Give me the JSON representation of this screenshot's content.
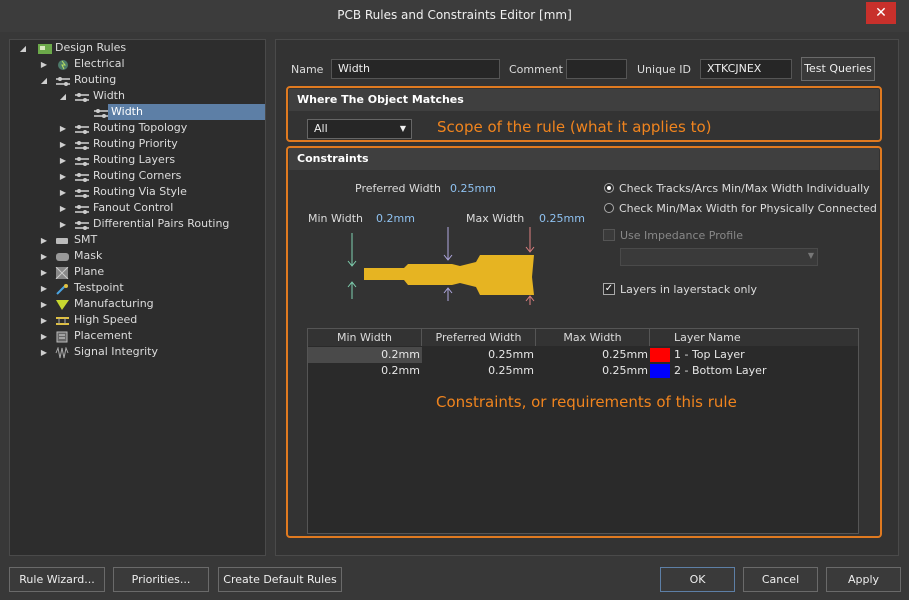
{
  "window": {
    "title": "PCB Rules and Constraints Editor [mm]",
    "close_glyph": "✕"
  },
  "tree": {
    "root": "Design Rules",
    "electrical": "Electrical",
    "routing": "Routing",
    "width_group": "Width",
    "width_rule": "Width",
    "routing_topology": "Routing Topology",
    "routing_priority": "Routing Priority",
    "routing_layers": "Routing Layers",
    "routing_corners": "Routing Corners",
    "routing_via_style": "Routing Via Style",
    "fanout_control": "Fanout Control",
    "diff_pairs": "Differential Pairs Routing",
    "smt": "SMT",
    "mask": "Mask",
    "plane": "Plane",
    "testpoint": "Testpoint",
    "manufacturing": "Manufacturing",
    "high_speed": "High Speed",
    "placement": "Placement",
    "signal_integrity": "Signal Integrity"
  },
  "header": {
    "name_label": "Name",
    "name_value": "Width",
    "comment_label": "Comment",
    "comment_value": "",
    "uid_label": "Unique ID",
    "uid_value": "XTKCJNEX",
    "test_queries": "Test Queries"
  },
  "where": {
    "title": "Where The Object Matches",
    "scope_value": "All",
    "annotation": "Scope of the rule (what it applies to)"
  },
  "constraints": {
    "title": "Constraints",
    "preferred_label": "Preferred Width",
    "preferred_value": "0.25mm",
    "min_label": "Min Width",
    "min_value": "0.2mm",
    "max_label": "Max Width",
    "max_value": "0.25mm",
    "radio_individual": "Check Tracks/Arcs Min/Max Width Individually",
    "radio_connected": "Check Min/Max Width for Physically Connected",
    "use_impedance": "Use Impedance Profile",
    "layers_only": "Layers in layerstack only",
    "annotation": "Constraints, or requirements of this rule",
    "table": {
      "headers": [
        "Min Width",
        "Preferred Width",
        "Max Width",
        "Layer Name"
      ],
      "rows": [
        {
          "min": "0.2mm",
          "pref": "0.25mm",
          "max": "0.25mm",
          "layer": "1 - Top Layer",
          "color": "#ff0000"
        },
        {
          "min": "0.2mm",
          "pref": "0.25mm",
          "max": "0.25mm",
          "layer": "2 - Bottom Layer",
          "color": "#0000ff"
        }
      ]
    }
  },
  "footer": {
    "rule_wizard": "Rule Wizard...",
    "priorities": "Priorities...",
    "create_default": "Create Default Rules",
    "ok": "OK",
    "cancel": "Cancel",
    "apply": "Apply"
  },
  "colors": {
    "accent_orange": "#f0841e",
    "selection": "#5d7fa6",
    "track_fill": "#e6b422"
  }
}
